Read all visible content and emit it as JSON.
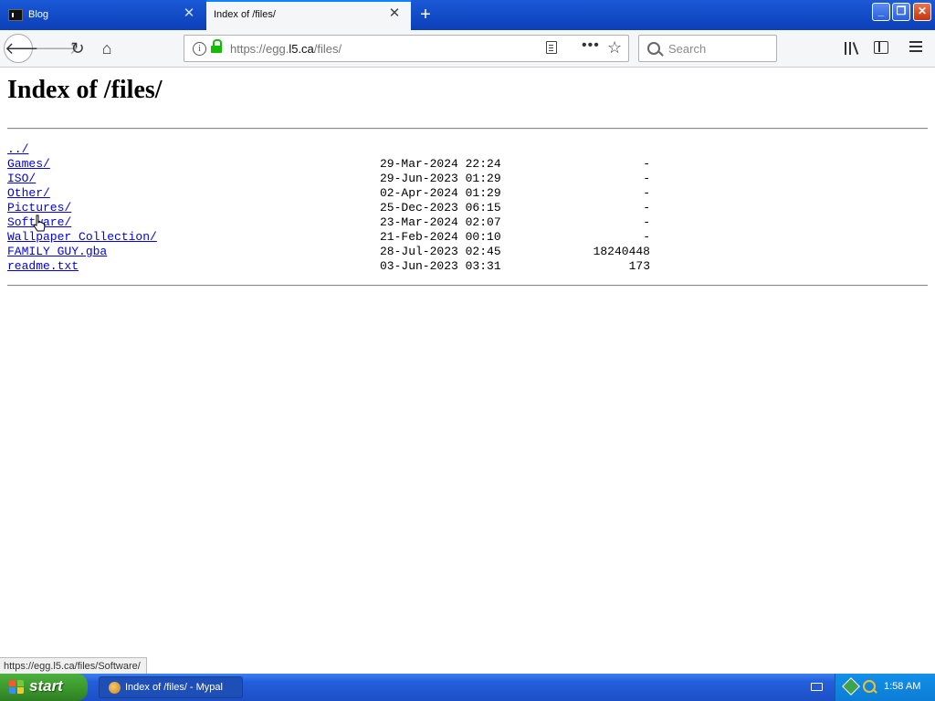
{
  "browser": {
    "tabs": [
      {
        "label": "Blog",
        "active": false
      },
      {
        "label": "Index of /files/",
        "active": true
      }
    ],
    "url": {
      "prefix": "https://egg.",
      "host": "l5.ca",
      "path": "/files/"
    },
    "search_placeholder": "Search",
    "status_url": "https://egg.l5.ca/files/Software/"
  },
  "page": {
    "title": "Index of /files/",
    "entries": [
      {
        "name": "../",
        "date": "",
        "size": ""
      },
      {
        "name": "Games/",
        "date": "29-Mar-2024 22:24",
        "size": "-"
      },
      {
        "name": "ISO/",
        "date": "29-Jun-2023 01:29",
        "size": "-"
      },
      {
        "name": "Other/",
        "date": "02-Apr-2024 01:29",
        "size": "-"
      },
      {
        "name": "Pictures/",
        "date": "25-Dec-2023 06:15",
        "size": "-"
      },
      {
        "name": "Software/",
        "date": "23-Mar-2024 02:07",
        "size": "-"
      },
      {
        "name": "Wallpaper Collection/",
        "date": "21-Feb-2024 00:10",
        "size": "-"
      },
      {
        "name": "FAMILY GUY.gba",
        "date": "28-Jul-2023 02:45",
        "size": "18240448"
      },
      {
        "name": "readme.txt",
        "date": "03-Jun-2023 03:31",
        "size": "173"
      }
    ]
  },
  "taskbar": {
    "start_label": "start",
    "task_label": "Index of /files/ - Mypal",
    "clock": "1:58 AM"
  },
  "colors": {
    "link": "#0000ee",
    "lock": "#12bc00",
    "taskbar": "#245edb",
    "start": "#3c9a2e"
  }
}
